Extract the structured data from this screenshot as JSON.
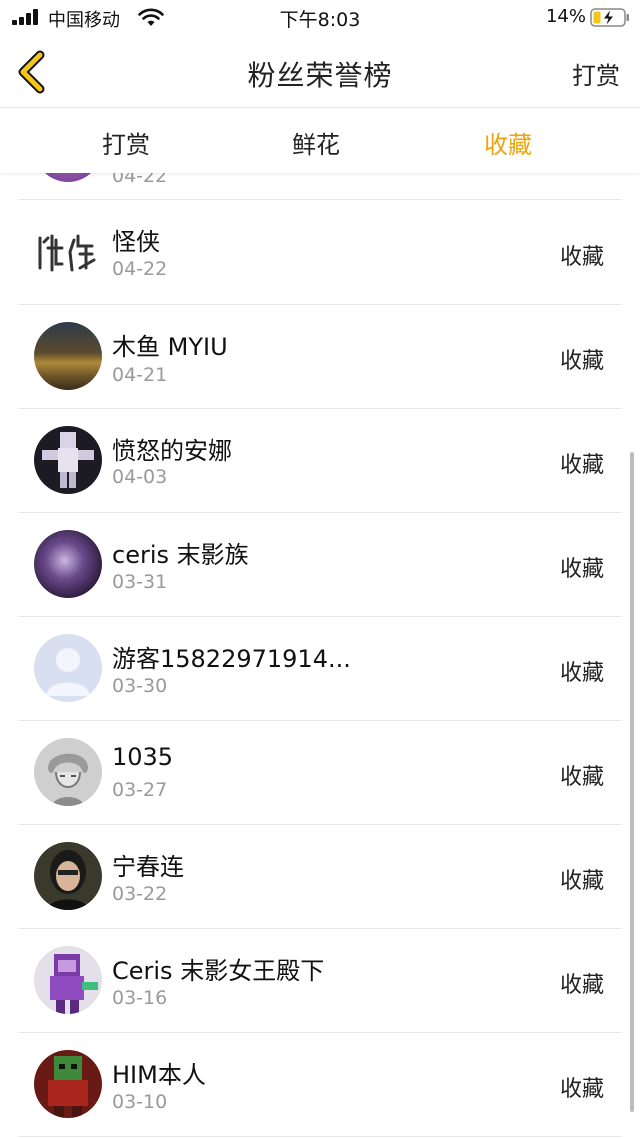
{
  "status_bar": {
    "carrier": "中国移动",
    "time": "下午8:03",
    "battery_percent": "14%"
  },
  "nav": {
    "title": "粉丝荣誉榜",
    "right_action": "打赏",
    "accent_color": "#f0a30a"
  },
  "tabs": [
    {
      "label": "打赏",
      "active": false
    },
    {
      "label": "鲜花",
      "active": false
    },
    {
      "label": "收藏",
      "active": true
    }
  ],
  "list": {
    "partial_top_date": "04-22",
    "rows": [
      {
        "name": "怪侠",
        "date": "04-22",
        "action": "收藏",
        "avatar": "calligraphy-logo"
      },
      {
        "name": "木鱼 MYIU",
        "date": "04-21",
        "action": "收藏",
        "avatar": "game-scene"
      },
      {
        "name": "愤怒的安娜",
        "date": "04-03",
        "action": "收藏",
        "avatar": "white-figure"
      },
      {
        "name": "ceris 末影族",
        "date": "03-31",
        "action": "收藏",
        "avatar": "purple-creature"
      },
      {
        "name": "游客15822971914...",
        "date": "03-30",
        "action": "收藏",
        "avatar": "default-user"
      },
      {
        "name": "1035",
        "date": "03-27",
        "action": "收藏",
        "avatar": "sketch-face"
      },
      {
        "name": "宁春连",
        "date": "03-22",
        "action": "收藏",
        "avatar": "photo-person"
      },
      {
        "name": "Ceris 末影女王殿下",
        "date": "03-16",
        "action": "收藏",
        "avatar": "purple-character"
      },
      {
        "name": "HIM本人",
        "date": "03-10",
        "action": "收藏",
        "avatar": "red-blocky"
      }
    ]
  }
}
